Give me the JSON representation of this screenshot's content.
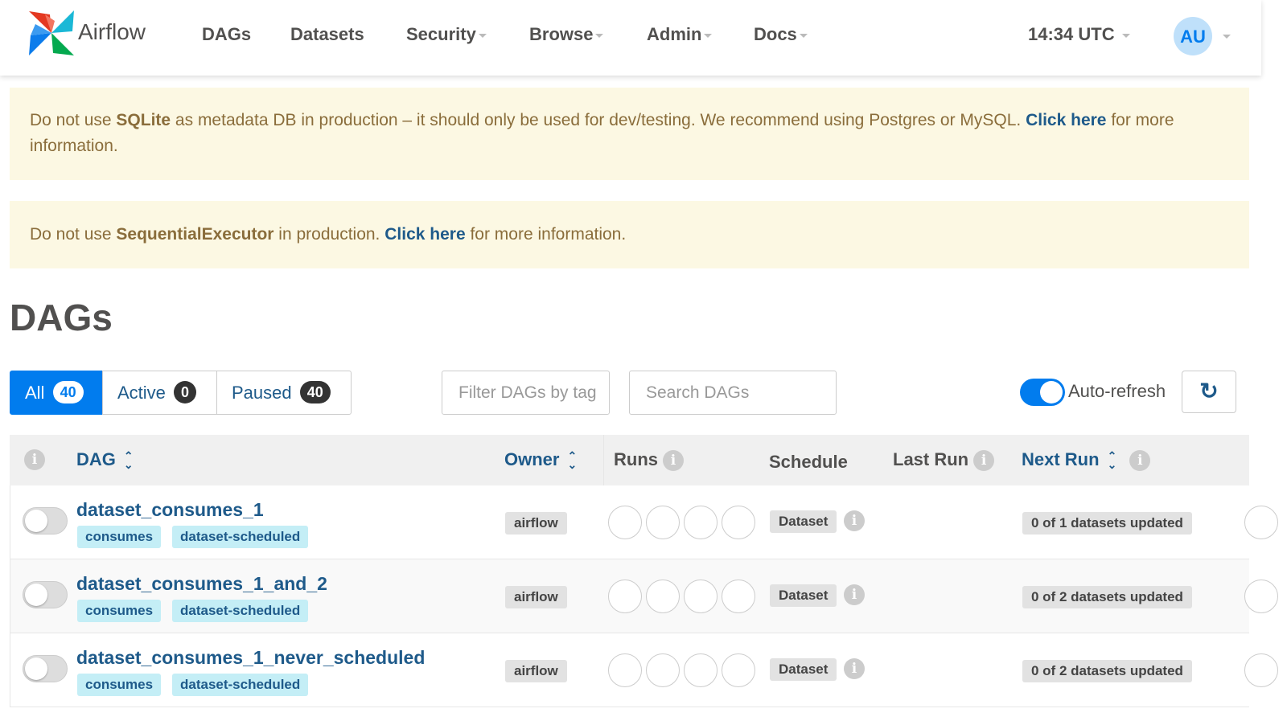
{
  "nav": {
    "brand": "Airflow",
    "items": [
      {
        "label": "DAGs",
        "caret": false
      },
      {
        "label": "Datasets",
        "caret": false
      },
      {
        "label": "Security",
        "caret": true
      },
      {
        "label": "Browse",
        "caret": true
      },
      {
        "label": "Admin",
        "caret": true
      },
      {
        "label": "Docs",
        "caret": true
      }
    ],
    "time": "14:34 UTC",
    "avatar": "AU"
  },
  "alerts": [
    {
      "pre": "Do not use ",
      "bold": "SQLite",
      "mid": " as metadata DB in production – it should only be used for dev/testing. We recommend using Postgres or MySQL. ",
      "link": "Click here",
      "post": " for more information."
    },
    {
      "pre": "Do not use ",
      "bold": "SequentialExecutor",
      "mid": " in production. ",
      "link": "Click here",
      "post": " for more information."
    }
  ],
  "page_title": "DAGs",
  "filters": [
    {
      "label": "All",
      "count": "40",
      "active": true
    },
    {
      "label": "Active",
      "count": "0",
      "active": false
    },
    {
      "label": "Paused",
      "count": "40",
      "active": false
    }
  ],
  "tag_filter_placeholder": "Filter DAGs by tag",
  "search_placeholder": "Search DAGs",
  "auto_refresh": {
    "label": "Auto-refresh",
    "on": true
  },
  "columns": {
    "dag": "DAG",
    "owner": "Owner",
    "runs": "Runs",
    "schedule": "Schedule",
    "last_run": "Last Run",
    "next_run": "Next Run"
  },
  "rows": [
    {
      "name": "dataset_consumes_1",
      "tags": [
        "consumes",
        "dataset-scheduled"
      ],
      "owner": "airflow",
      "schedule": "Dataset",
      "next_run": "0 of 1 datasets updated",
      "paused": true
    },
    {
      "name": "dataset_consumes_1_and_2",
      "tags": [
        "consumes",
        "dataset-scheduled"
      ],
      "owner": "airflow",
      "schedule": "Dataset",
      "next_run": "0 of 2 datasets updated",
      "paused": true
    },
    {
      "name": "dataset_consumes_1_never_scheduled",
      "tags": [
        "consumes",
        "dataset-scheduled"
      ],
      "owner": "airflow",
      "schedule": "Dataset",
      "next_run": "0 of 2 datasets updated",
      "paused": true
    }
  ],
  "colors": {
    "accent": "#017cee",
    "link": "#1e5a8a",
    "alert_bg": "#fcf8e3",
    "tag_bg": "#c4eef6"
  }
}
